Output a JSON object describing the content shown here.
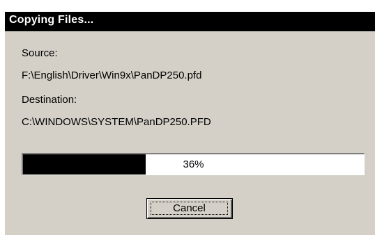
{
  "window": {
    "title": "Copying Files..."
  },
  "source": {
    "label": "Source:",
    "value": "F:\\English\\Driver\\Win9x\\PanDP250.pfd"
  },
  "destination": {
    "label": "Destination:",
    "value": "C:\\WINDOWS\\SYSTEM\\PanDP250.PFD"
  },
  "progress": {
    "percent": 36,
    "text": "36%"
  },
  "buttons": {
    "cancel": "Cancel"
  },
  "colors": {
    "dialog_bg": "#d4d0c8",
    "titlebar_bg": "#000000",
    "progress_fill": "#000000"
  }
}
